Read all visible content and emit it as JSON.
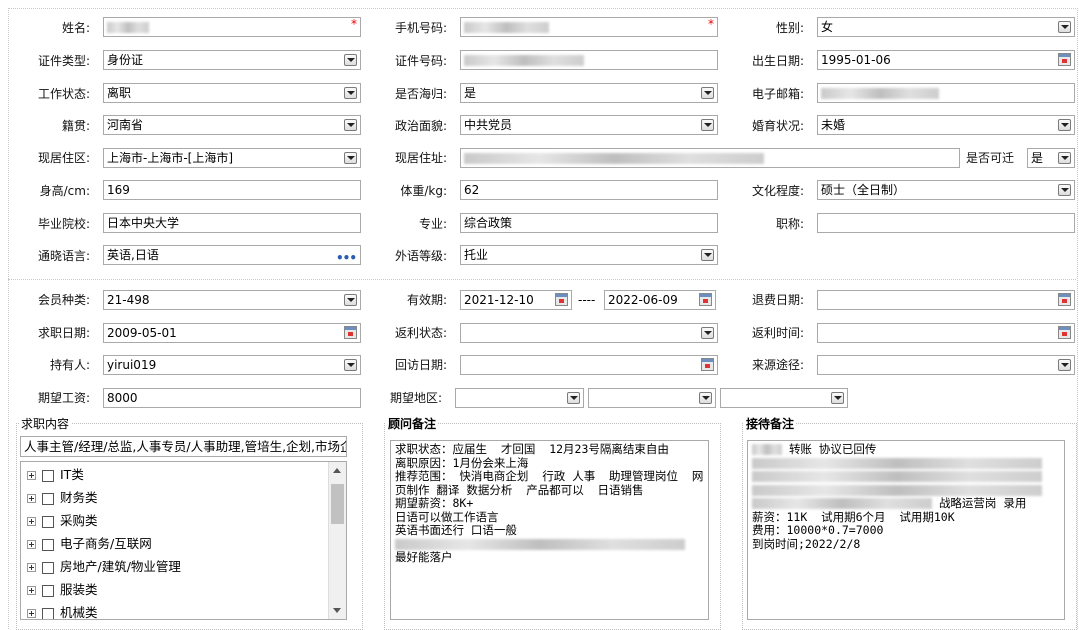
{
  "basic": {
    "name_label": "姓名:",
    "phone_label": "手机号码:",
    "gender_label": "性别:",
    "gender_value": "女",
    "id_type_label": "证件类型:",
    "id_type_value": "身份证",
    "id_no_label": "证件号码:",
    "birth_label": "出生日期:",
    "birth_value": "1995-01-06",
    "work_status_label": "工作状态:",
    "work_status_value": "离职",
    "returnee_label": "是否海归:",
    "returnee_value": "是",
    "email_label": "电子邮箱:",
    "native_label": "籍贯:",
    "native_value": "河南省",
    "political_label": "政治面貌:",
    "political_value": "中共党员",
    "marital_label": "婚育状况:",
    "marital_value": "未婚",
    "residence_label": "现居住区:",
    "residence_value": "上海市-上海市-[上海市]",
    "address_label": "现居住址:",
    "relocate_label": "是否可迁",
    "relocate_value": "是",
    "height_label": "身高/cm:",
    "height_value": "169",
    "weight_label": "体重/kg:",
    "weight_value": "62",
    "education_label": "文化程度:",
    "education_value": "硕士（全日制）",
    "school_label": "毕业院校:",
    "school_value": "日本中央大学",
    "major_label": "专业:",
    "major_value": "综合政策",
    "title_label": "职称:",
    "languages_label": "通晓语言:",
    "languages_value": "英语,日语",
    "lang_level_label": "外语等级:",
    "lang_level_value": "托业"
  },
  "membership": {
    "type_label": "会员种类:",
    "type_value": "21-498",
    "validity_label": "有效期:",
    "valid_from": "2021-12-10",
    "range_sep": "----",
    "valid_to": "2022-06-09",
    "refund_date_label": "退费日期:",
    "job_date_label": "求职日期:",
    "job_date_value": "2009-05-01",
    "rebate_status_label": "返利状态:",
    "rebate_time_label": "返利时间:",
    "holder_label": "持有人:",
    "holder_value": "yirui019",
    "visit_date_label": "回访日期:",
    "source_label": "来源途径:",
    "salary_label": "期望工资:",
    "salary_value": "8000",
    "region_label": "期望地区:"
  },
  "job_content": {
    "title": "求职内容",
    "summary": "人事主管/经理/总监,人事专员/人事助理,管培生,企划,市场企",
    "categories": [
      "IT类",
      "财务类",
      "采购类",
      "电子商务/互联网",
      "房地产/建筑/物业管理",
      "服装类",
      "机械类"
    ]
  },
  "consultant_notes": {
    "title": "顾问备注",
    "text": "求职状态：应届生  才回国  12月23号隔离结束自由\n离职原因：1月份会来上海\n推荐范围： 快消电商企划  行政 人事  助理管理岗位  网页制作 翻译 数据分析  产品都可以  日语销售\n期望薪资：8K+\n日语可以做工作语言\n英语书面还行 口语一般",
    "last_line": "最好能落户"
  },
  "reception_notes": {
    "title": "接待备注",
    "first_line": "转账 协议已回传",
    "role_line": "战略运营岗 录用",
    "lines": [
      "薪资：11K  试用期6个月  试用期10K",
      "费用：10000*0.7=7000",
      "到岗时间;2022/2/8"
    ]
  },
  "icons": {
    "dropdown": "chevron-down-icon",
    "calendar": "calendar-icon",
    "more": "ellipsis-icon"
  }
}
